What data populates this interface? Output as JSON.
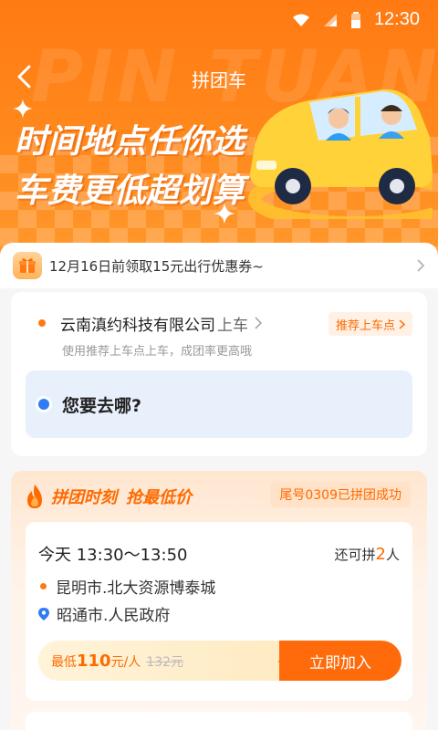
{
  "status": {
    "time": "12:30"
  },
  "nav": {
    "title": "拼团车"
  },
  "hero": {
    "watermark": "PIN TUAN",
    "headline1": "时间地点任你选",
    "headline2": "车费更低超划算"
  },
  "coupon": {
    "text": "12月16日前领取15元出行优惠券~"
  },
  "route": {
    "pickup_name": "云南滇约科技有限公司",
    "pickup_suffix": "上车",
    "recommend_label": "推荐上车点",
    "hint": "使用推荐上车点上车，成团率更高哦",
    "destination_placeholder": "您要去哪?"
  },
  "group": {
    "title": "拼团时刻",
    "title2": "抢最低价",
    "success_badge": "尾号0309已拼团成功",
    "trip": {
      "time": "今天 13:30～13:50",
      "seats_prefix": "还可拼",
      "seats_count": "2",
      "seats_suffix": "人",
      "from": "昆明市.北大资源博泰城",
      "to": "昭通市.人民政府",
      "price_prefix": "最低",
      "price": "110",
      "price_unit": "元/人",
      "original_price": "132元",
      "join_label": "立即加入"
    }
  },
  "colors": {
    "brand": "#ff7a12",
    "accent": "#ff6a00",
    "blue": "#2f7cf6"
  }
}
